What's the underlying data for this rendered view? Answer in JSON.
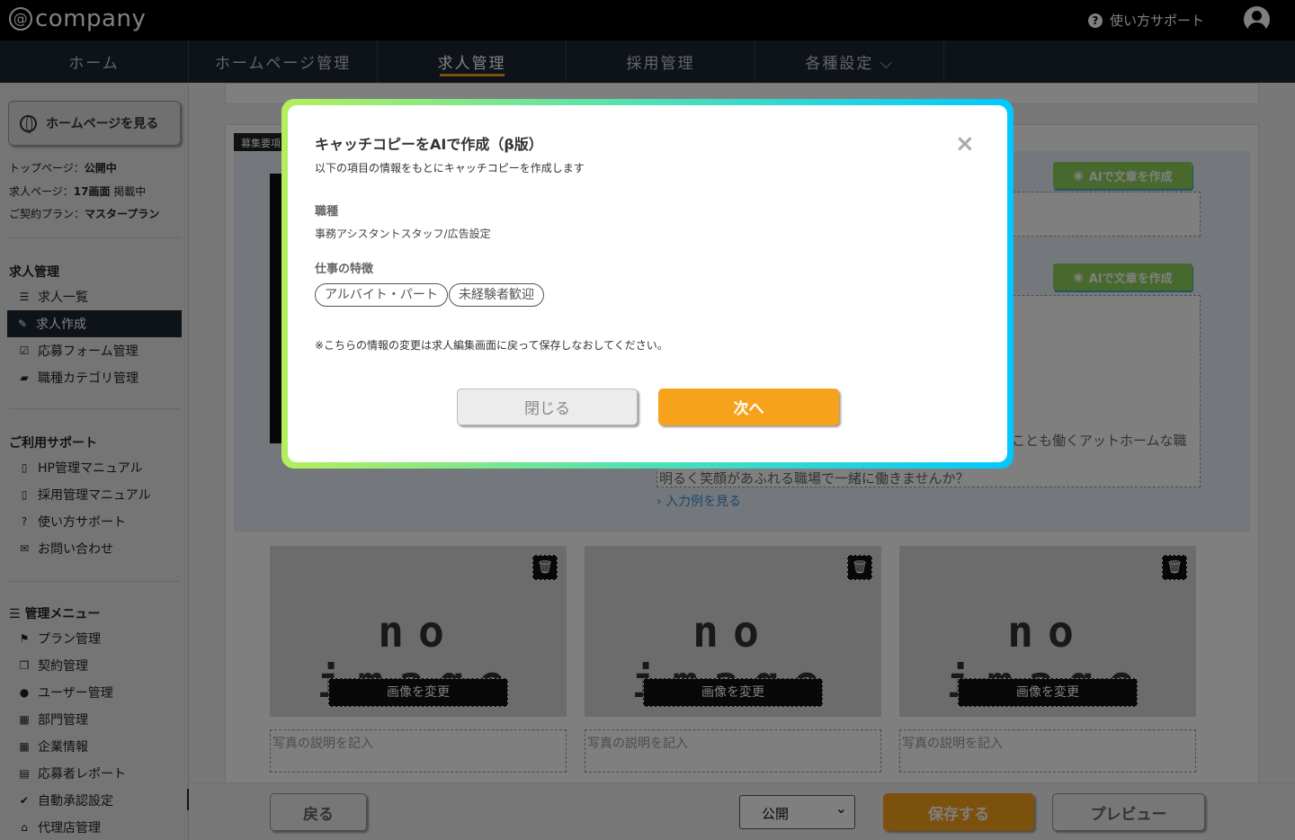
{
  "header": {
    "logo_text": "company",
    "logo_at": "@",
    "support_label": "使い方サポート"
  },
  "nav": {
    "tabs": [
      {
        "label": "ホーム"
      },
      {
        "label": "ホームページ管理"
      },
      {
        "label": "求人管理"
      },
      {
        "label": "採用管理"
      },
      {
        "label": "各種設定 ⌵"
      }
    ],
    "active_tab": "求人管理"
  },
  "sidebar": {
    "view_homepage_button": "ホームページを見る",
    "status": {
      "top_page_label": "トップページ：",
      "top_page_value": "公開中",
      "job_page_label": "求人ページ：",
      "job_page_value": "17画面",
      "job_page_suffix": " 掲載中",
      "plan_label": "ご契約プラン：",
      "plan_value": "マスタープラン"
    },
    "job_section_title": "求人管理",
    "job_items": [
      {
        "label": "求人一覧",
        "icon": "list-icon"
      },
      {
        "label": "求人作成",
        "icon": "edit-icon"
      },
      {
        "label": "応募フォーム管理",
        "icon": "checkbox-icon"
      },
      {
        "label": "職種カテゴリ管理",
        "icon": "briefcase-icon"
      }
    ],
    "support_section_title": "ご利用サポート",
    "support_items": [
      {
        "label": "HP管理マニュアル",
        "icon": "pdf-icon"
      },
      {
        "label": "採用管理マニュアル",
        "icon": "pdf-icon"
      },
      {
        "label": "使い方サポート",
        "icon": "question-icon"
      },
      {
        "label": "お問い合わせ",
        "icon": "mail-icon"
      }
    ],
    "admin_section_title": "管理メニュー",
    "admin_items": [
      {
        "label": "プラン管理",
        "icon": "flag-icon"
      },
      {
        "label": "契約管理",
        "icon": "copy-icon"
      },
      {
        "label": "ユーザー管理",
        "icon": "user-icon"
      },
      {
        "label": "部門管理",
        "icon": "building-icon"
      },
      {
        "label": "企業情報",
        "icon": "building-icon"
      },
      {
        "label": "応募者レポート",
        "icon": "id-card-icon"
      },
      {
        "label": "自動承認設定",
        "icon": "check-circle-icon"
      },
      {
        "label": "代理店管理",
        "icon": "bank-icon"
      }
    ]
  },
  "main": {
    "section_tag": "募集要項",
    "ai_button_label": "AIで文章を作成",
    "bg_text_line1": "ことも働くアットホームな職",
    "bg_text_line2": "明るく笑顔があふれる職場で一緒に働きませんか？",
    "example_link": "入力例を見る",
    "photos": [
      {
        "no_image": "no image",
        "change_button": "画像を変更",
        "caption_placeholder": "写真の説明を記入"
      },
      {
        "no_image": "no image",
        "change_button": "画像を変更",
        "caption_placeholder": "写真の説明を記入"
      },
      {
        "no_image": "no image",
        "change_button": "画像を変更",
        "caption_placeholder": "写真の説明を記入"
      }
    ]
  },
  "bottom": {
    "back_button": "戻る",
    "status_select": "公開",
    "save_button": "保存する",
    "preview_button": "プレビュー"
  },
  "modal": {
    "title": "キャッチコピーをAIで作成（β版）",
    "subtitle": "以下の項目の情報をもとにキャッチコピーを作成します",
    "job_type_label": "職種",
    "job_type_value": "事務アシスタントスタッフ/広告設定",
    "features_label": "仕事の特徴",
    "features": [
      "アルバイト・パート",
      "未経験者歓迎"
    ],
    "note": "※こちらの情報の変更は求人編集画面に戻って保存しなおしてください。",
    "close_button": "閉じる",
    "next_button": "次へ",
    "close_icon": "×"
  },
  "colors": {
    "accent_orange": "#f7a21b",
    "nav_dark": "#1d2734",
    "ai_green": "#8fd35d"
  }
}
